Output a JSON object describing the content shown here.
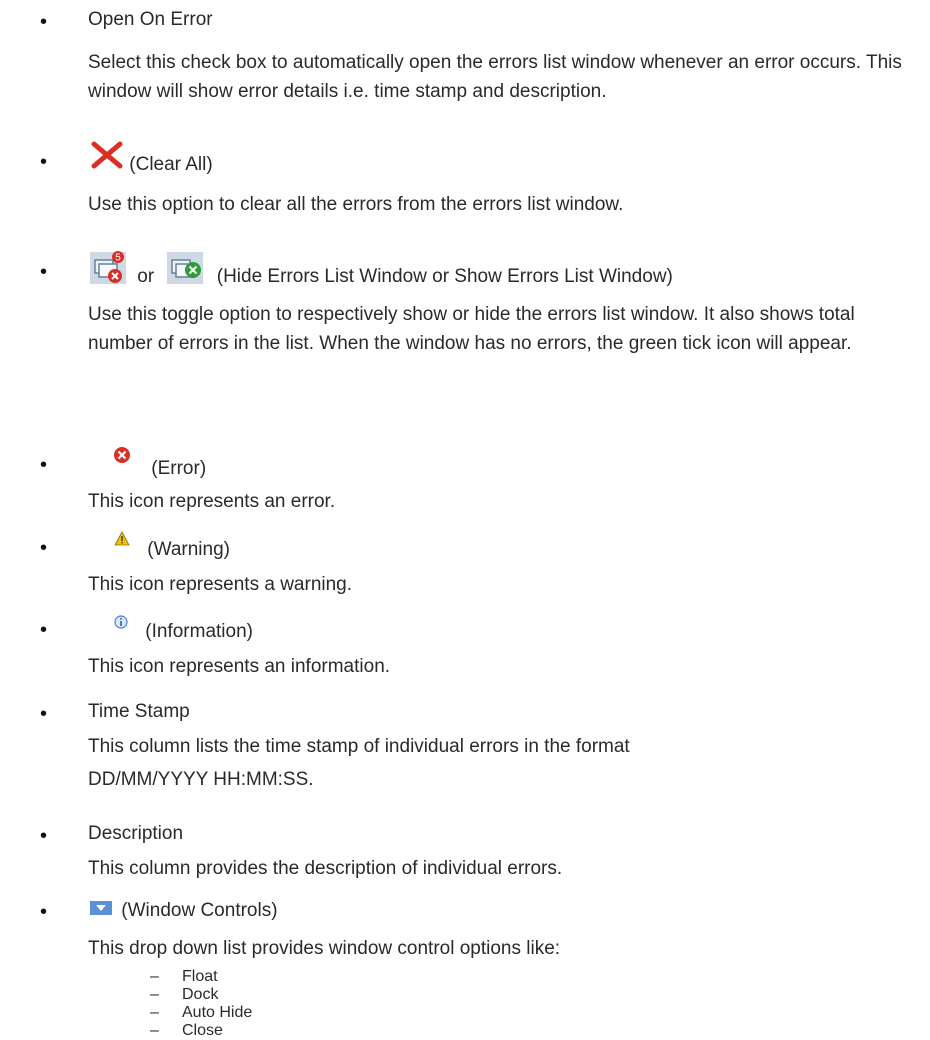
{
  "items": [
    {
      "heading": "Open On Error",
      "body": "Select this check box to automatically open the errors list window whenever an error occurs. This window will show error details i.e. time stamp and description."
    },
    {
      "icon": "clear-all-x-icon",
      "heading": "(Clear All)",
      "body": "Use this option to clear all the errors from the errors list window."
    },
    {
      "icon": "hide-errors-window-icon",
      "icon2": "show-errors-window-icon",
      "badge": "5",
      "or": "or",
      "heading": "(Hide Errors List Window or Show Errors List Window)",
      "body": "Use this toggle option to respectively show or hide the errors list window. It also shows total number of errors in the list.  When the window has no errors, the green tick icon will appear."
    },
    {
      "icon": "error-icon",
      "heading": "(Error)",
      "body": "This icon represents an error."
    },
    {
      "icon": "warning-icon",
      "heading": "(Warning)",
      "body": "This icon represents a warning."
    },
    {
      "icon": "information-icon",
      "heading": "(Information)",
      "body": "This icon represents an information."
    },
    {
      "heading": "Time Stamp",
      "body_lines": [
        "This column lists the time stamp of individual errors in the format",
        "DD/MM/YYYY HH:MM:SS."
      ]
    },
    {
      "heading": "Description",
      "body": "This column provides the description of individual errors."
    },
    {
      "icon": "window-controls-dropdown-icon",
      "heading": "(Window Controls)",
      "body": "This drop down list provides window control options like:",
      "options": [
        "Float",
        "Dock",
        "Auto Hide",
        "Close"
      ]
    }
  ],
  "bullet": "•",
  "dash": "–",
  "colors": {
    "text": "#2a2a2a",
    "error_red": "#d93025",
    "green": "#2e9e3a",
    "warning_yellow": "#f2c200",
    "info_blue": "#4a7fd4",
    "dropdown_blue": "#5b8fd6"
  }
}
